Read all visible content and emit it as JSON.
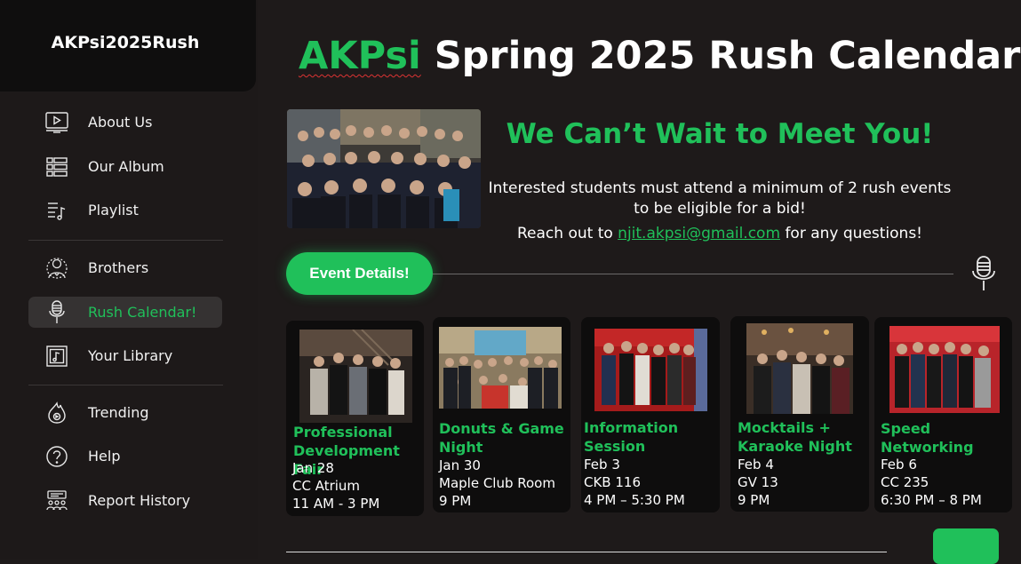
{
  "sidebar": {
    "brand": "AKPsi2025Rush",
    "items": [
      {
        "label": "About Us",
        "icon": "video-play-icon"
      },
      {
        "label": "Our Album",
        "icon": "album-icon"
      },
      {
        "label": "Playlist",
        "icon": "playlist-icon"
      },
      {
        "label": "Brothers",
        "icon": "brothers-icon"
      },
      {
        "label": "Rush Calendar!",
        "icon": "microphone-icon",
        "active": true
      },
      {
        "label": "Your Library",
        "icon": "library-icon"
      },
      {
        "label": "Trending",
        "icon": "trending-icon"
      },
      {
        "label": "Help",
        "icon": "help-icon"
      },
      {
        "label": "Report History",
        "icon": "report-history-icon"
      }
    ]
  },
  "header": {
    "title_accent": "AKPsi",
    "title_rest": "Spring 2025 Rush Calendar"
  },
  "intro": {
    "tagline": "We Can’t Wait to Meet You!",
    "requirement_line1": "Interested students must attend a minimum of 2 rush events",
    "requirement_line2": "to be eligible for a bid!",
    "contact_prefix": "Reach out to",
    "contact_email": "njit.akpsi@gmail.com",
    "contact_suffix": "for any questions!"
  },
  "event_button": "Event Details!",
  "events": [
    {
      "title": "Professional Development Fair",
      "date": "Jan 28",
      "location": "CC Atrium",
      "time": "11 AM - 3 PM"
    },
    {
      "title": "Donuts & Game Night",
      "date": "Jan 30",
      "location": "Maple Club Room",
      "time": "9 PM"
    },
    {
      "title": "Information Session",
      "date": "Feb 3",
      "location": "CKB 116",
      "time": "4 PM – 5:30 PM"
    },
    {
      "title": "Mocktails + Karaoke Night",
      "date": "Feb 4",
      "location": "GV 13",
      "time": "9 PM"
    },
    {
      "title": "Speed Networking",
      "date": "Feb 6",
      "location": "CC 235",
      "time": "6:30 PM – 8 PM"
    }
  ],
  "colors": {
    "accent": "#20c05a",
    "background": "#1e1a1a",
    "sidebar_brand_bg": "#0f0e0e",
    "card_bg": "#0e0d0d",
    "active_item_bg": "#353232"
  }
}
